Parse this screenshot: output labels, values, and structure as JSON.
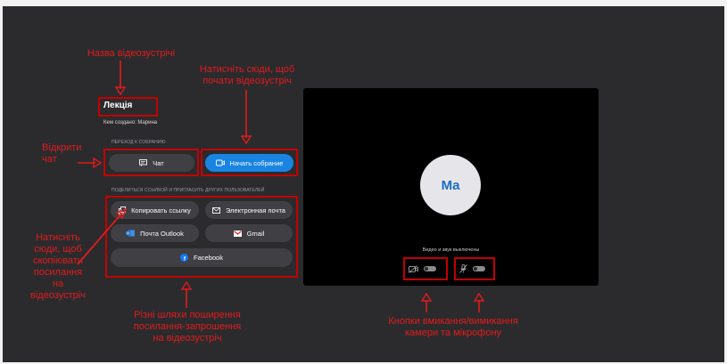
{
  "meeting": {
    "title": "Лекція",
    "created_by": "Кем создано: Марина"
  },
  "join_section": {
    "label": "ПЕРЕХОД К СОБРАНИЮ",
    "chat_button": "Чат",
    "start_button": "Начать собрание"
  },
  "share_section": {
    "label": "ПОДЕЛИТЬСЯ ССЫЛКОЙ И ПРИГЛАСИТЬ ДРУГИХ ПОЛЬЗОВАТЕЛЕЙ",
    "copy_link": "Копировать ссылку",
    "email": "Электронная почта",
    "outlook": "Почта Outlook",
    "gmail": "Gmail",
    "facebook": "Facebook"
  },
  "preview": {
    "avatar_initials": "Ma",
    "status": "Видео и звук выключены"
  },
  "annotations": {
    "meeting_name": "Назва відеозустрічі",
    "start_here": "Натисніть сюди, щоб почати відеозустріч",
    "open_chat": "Відкрити чат",
    "copy_link_hint": "Натисніть сюди, щоб скопіювати посилання на відеозустріч",
    "share_ways": "Різні шляхи поширення посилання-запрошення на відеозустріч",
    "cam_mic": "Кнопки вмикання/вимикання камери та мікрофону"
  },
  "colors": {
    "annotation_red": "#e01b1b",
    "accent_blue": "#1a84e2",
    "background_dark": "#2b2b2e",
    "preview_black": "#000000"
  }
}
